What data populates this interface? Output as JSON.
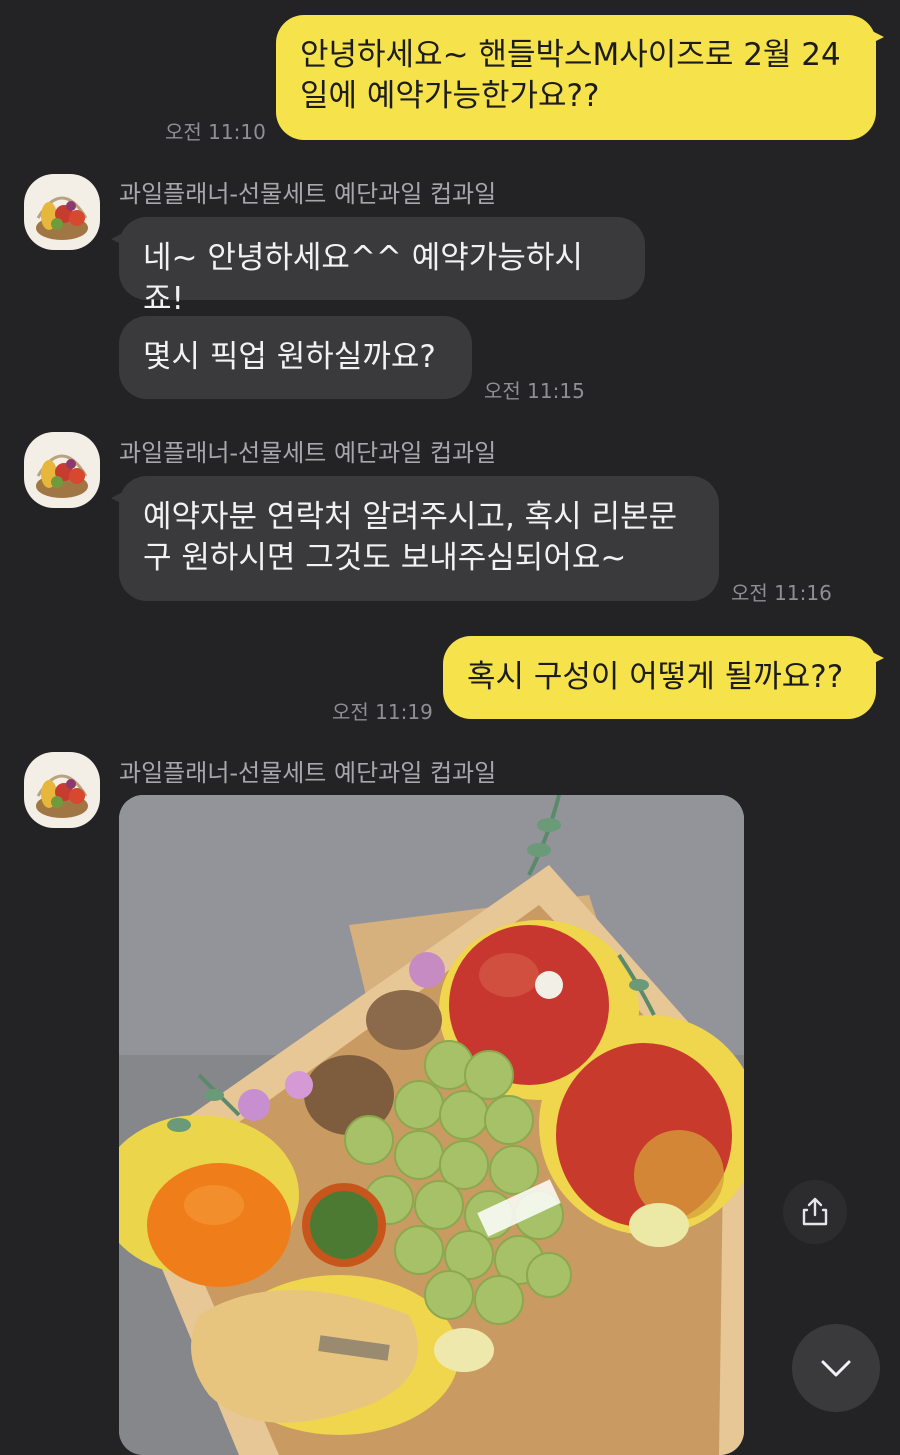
{
  "messages": [
    {
      "type": "sent",
      "text": "안녕하세요~ 핸들박스M사이즈로 2월 24\n일에 예약가능한가요??",
      "time": "오전 11:10"
    },
    {
      "type": "received",
      "sender": "과일플래너-선물세트 예단과일 컵과일",
      "texts": [
        "네~ 안녕하세요^^ 예약가능하시죠!",
        "몇시 픽업 원하실까요?"
      ],
      "time": "오전 11:15"
    },
    {
      "type": "received",
      "sender": "과일플래너-선물세트 예단과일 컵과일",
      "texts": [
        "예약자분 연락처 알려주시고, 혹시 리본문\n구 원하시면 그것도 보내주심되어요~"
      ],
      "time": "오전 11:16"
    },
    {
      "type": "sent",
      "text": "혹시 구성이 어떻게 될까요??",
      "time": "오전 11:19"
    },
    {
      "type": "received",
      "sender": "과일플래너-선물세트 예단과일 컵과일",
      "image": "fruit-gift-box-photo"
    }
  ],
  "icons": {
    "share": "share-icon",
    "scroll_down": "chevron-down-icon"
  },
  "colors": {
    "background": "#232325",
    "sent_bubble": "#f6e24b",
    "received_bubble": "#3a3a3c",
    "timestamp": "#8e8e93"
  }
}
